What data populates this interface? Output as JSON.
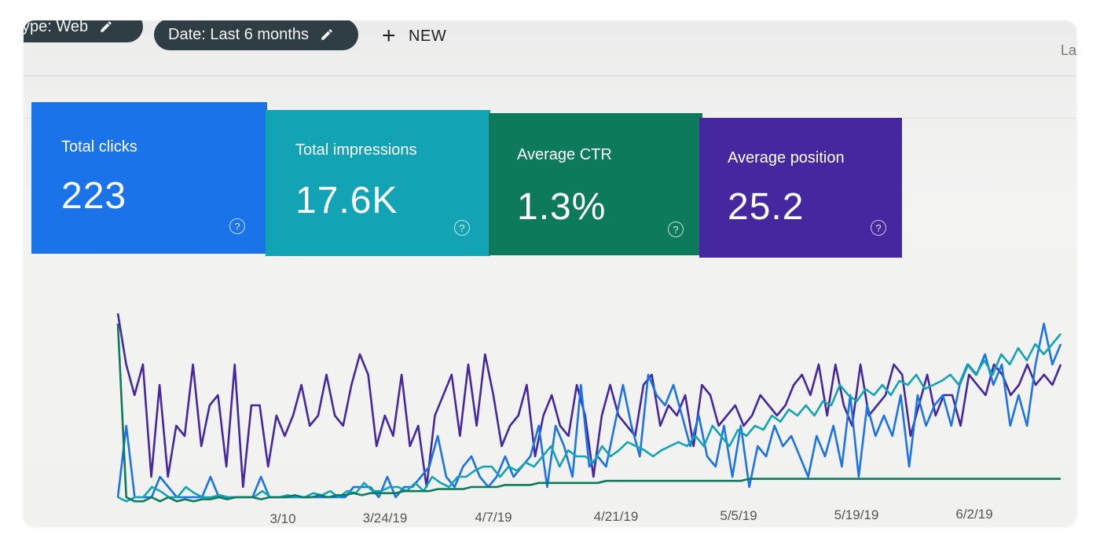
{
  "filters": {
    "type_chip": "ype: Web",
    "date_chip": "Date: Last 6 months",
    "new_label": "NEW",
    "corner_text": "La"
  },
  "metrics": [
    {
      "label": "Total clicks",
      "value": "223",
      "color": "#1a73e8"
    },
    {
      "label": "Total impressions",
      "value": "17.6K",
      "color": "#12a4b4"
    },
    {
      "label": "Average CTR",
      "value": "1.3%",
      "color": "#0d7a5c"
    },
    {
      "label": "Average position",
      "value": "25.2",
      "color": "#4527a0"
    }
  ],
  "chart_data": {
    "type": "line",
    "x_ticks": [
      "3/10",
      "3/24/19",
      "4/7/19",
      "4/21/19",
      "5/5/19",
      "5/19/19",
      "6/2/19"
    ],
    "series": [
      {
        "name": "Average position",
        "color": "#4527a0",
        "values": [
          5,
          30,
          45,
          30,
          85,
          40,
          85,
          60,
          65,
          30,
          70,
          50,
          45,
          80,
          30,
          90,
          50,
          50,
          80,
          55,
          65,
          55,
          40,
          60,
          55,
          35,
          55,
          60,
          40,
          25,
          35,
          70,
          55,
          65,
          35,
          70,
          60,
          90,
          55,
          45,
          35,
          65,
          30,
          60,
          25,
          45,
          70,
          60,
          55,
          40,
          75,
          55,
          45,
          60,
          65,
          40,
          55,
          85,
          55,
          40,
          55,
          60,
          65,
          40,
          35,
          60,
          50,
          55,
          45,
          70,
          40,
          45,
          60,
          55,
          50,
          60,
          55,
          45,
          50,
          55,
          50,
          40,
          35,
          45,
          30,
          55,
          30,
          50,
          60,
          30,
          55,
          50,
          45,
          30,
          35,
          65,
          50,
          35,
          55,
          45,
          45,
          60,
          35,
          40,
          45,
          30,
          35,
          45,
          40,
          30,
          40,
          35,
          40,
          30
        ]
      },
      {
        "name": "Total clicks",
        "color": "#1a73e8",
        "values": [
          95,
          60,
          95,
          95,
          95,
          85,
          90,
          95,
          95,
          95,
          95,
          85,
          95,
          95,
          95,
          95,
          95,
          85,
          95,
          95,
          95,
          95,
          95,
          95,
          95,
          95,
          95,
          95,
          90,
          90,
          90,
          95,
          85,
          95,
          90,
          90,
          85,
          80,
          65,
          85,
          90,
          80,
          75,
          85,
          90,
          85,
          75,
          85,
          80,
          75,
          60,
          90,
          60,
          70,
          85,
          40,
          80,
          75,
          80,
          60,
          40,
          60,
          75,
          35,
          45,
          50,
          40,
          55,
          70,
          55,
          75,
          80,
          60,
          85,
          60,
          90,
          70,
          75,
          60,
          70,
          65,
          75,
          85,
          65,
          75,
          60,
          80,
          45,
          85,
          50,
          65,
          55,
          65,
          45,
          80,
          45,
          60,
          50,
          45,
          60,
          40,
          30,
          35,
          25,
          40,
          30,
          60,
          45,
          60,
          30,
          10,
          30,
          20
        ]
      },
      {
        "name": "Total impressions",
        "color": "#12a4b4",
        "values": [
          95,
          97,
          95,
          95,
          90,
          92,
          95,
          95,
          90,
          93,
          95,
          95,
          94,
          95,
          95,
          95,
          95,
          92,
          95,
          95,
          94,
          95,
          95,
          93,
          94,
          92,
          95,
          92,
          93,
          88,
          92,
          92,
          90,
          90,
          92,
          88,
          92,
          85,
          88,
          90,
          85,
          85,
          82,
          80,
          80,
          85,
          80,
          82,
          78,
          80,
          75,
          70,
          80,
          72,
          75,
          75,
          78,
          70,
          75,
          72,
          68,
          70,
          72,
          75,
          72,
          70,
          68,
          70,
          65,
          70,
          60,
          65,
          70,
          62,
          65,
          60,
          62,
          55,
          58,
          52,
          55,
          50,
          55,
          48,
          50,
          40,
          45,
          48,
          42,
          45,
          40,
          45,
          38,
          40,
          35,
          42,
          40,
          38,
          35,
          40,
          30,
          35,
          28,
          35,
          25,
          30,
          22,
          28,
          20,
          25,
          20,
          15
        ]
      },
      {
        "name": "Average CTR",
        "color": "#0d7a5c",
        "values": [
          10,
          95,
          97,
          97,
          95,
          97,
          95,
          97,
          96,
          97,
          96,
          96,
          95,
          96,
          95,
          95,
          95,
          96,
          95,
          95,
          95,
          94,
          95,
          95,
          94,
          95,
          94,
          94,
          93,
          94,
          93,
          93,
          93,
          93,
          92,
          92,
          92,
          92,
          91,
          91,
          91,
          91,
          90,
          90,
          90,
          90,
          89,
          89,
          89,
          89,
          88,
          88,
          88,
          88,
          88,
          88,
          88,
          88,
          87,
          87,
          87,
          87,
          87,
          87,
          87,
          87,
          87,
          87,
          87,
          87,
          87,
          87,
          87,
          87,
          87,
          86,
          86,
          86,
          86,
          86,
          86,
          86,
          86,
          86,
          86,
          86,
          86,
          86,
          86,
          86,
          86,
          86,
          86,
          86,
          86,
          86,
          86,
          86,
          86,
          86,
          86,
          86,
          86,
          86,
          86,
          86,
          86,
          86,
          86,
          86,
          86,
          86,
          86
        ]
      }
    ],
    "ylim": [
      0,
      100
    ],
    "grid": false,
    "legend": "none"
  }
}
